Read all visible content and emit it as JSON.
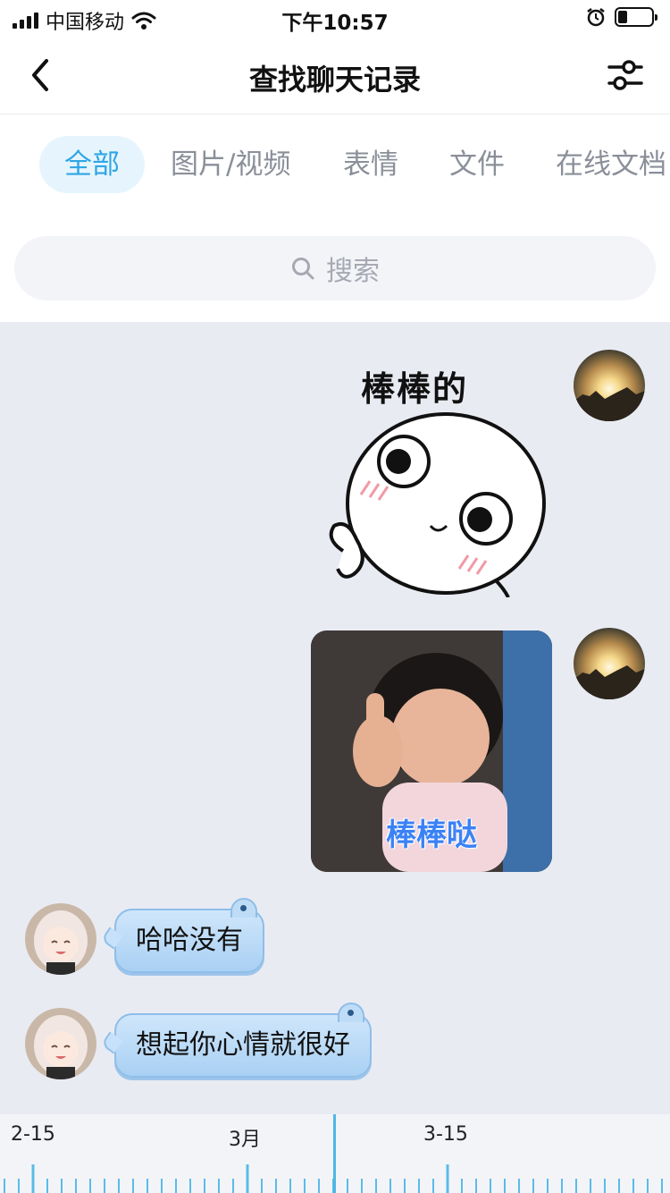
{
  "status_bar": {
    "carrier": "中国移动",
    "time": "下午10:57"
  },
  "nav": {
    "title": "查找聊天记录"
  },
  "tabs": [
    {
      "label": "全部",
      "active": true
    },
    {
      "label": "图片/视频",
      "active": false
    },
    {
      "label": "表情",
      "active": false
    },
    {
      "label": "文件",
      "active": false
    },
    {
      "label": "在线文档",
      "active": false
    }
  ],
  "search": {
    "placeholder": "搜索"
  },
  "messages": [
    {
      "side": "right",
      "type": "sticker",
      "sticker_text": "棒棒的"
    },
    {
      "side": "right",
      "type": "image",
      "caption": "棒棒哒"
    },
    {
      "side": "left",
      "type": "text",
      "text": "哈哈没有"
    },
    {
      "side": "left",
      "type": "text",
      "text": "想起你心情就很好"
    }
  ],
  "timeline": {
    "labels": [
      "2-15",
      "3月",
      "3-15"
    ]
  },
  "colors": {
    "accent": "#2fa6e6",
    "chat_bg": "#e9ebf3",
    "bubble": "#b9d9f6"
  }
}
